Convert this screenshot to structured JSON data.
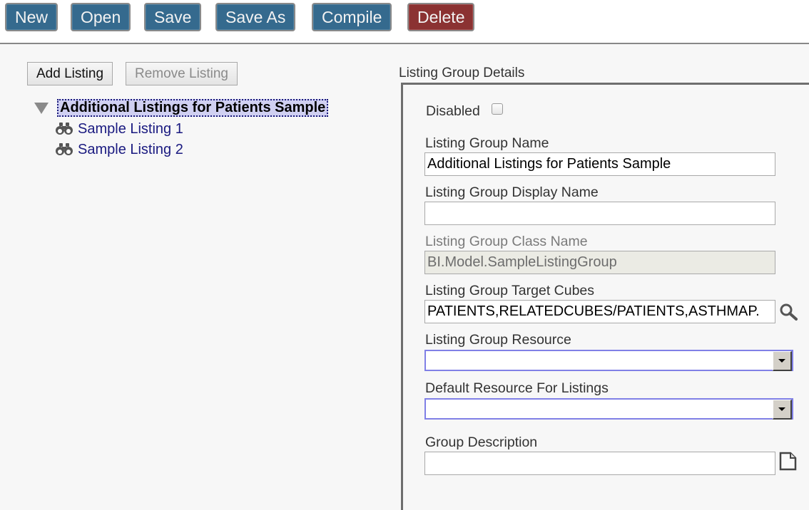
{
  "toolbar": {
    "buttons": [
      {
        "label": "New"
      },
      {
        "label": "Open"
      },
      {
        "label": "Save"
      },
      {
        "label": "Save As"
      },
      {
        "label": "Compile"
      },
      {
        "label": "Delete"
      }
    ]
  },
  "left_panel": {
    "add_listing_label": "Add Listing",
    "remove_listing_label": "Remove Listing",
    "tree": {
      "root": {
        "label": "Additional Listings for Patients Sample",
        "expanded": true,
        "selected": true
      },
      "children": [
        {
          "label": "Sample Listing 1",
          "icon": "binoculars-icon"
        },
        {
          "label": "Sample Listing 2",
          "icon": "binoculars-icon"
        }
      ]
    }
  },
  "details": {
    "title": "Listing Group Details",
    "disabled": {
      "label": "Disabled",
      "checked": false
    },
    "fields": {
      "name": {
        "label": "Listing Group Name",
        "value": "Additional Listings for Patients Sample"
      },
      "display_name": {
        "label": "Listing Group Display Name",
        "value": ""
      },
      "class_name": {
        "label": "Listing Group Class Name",
        "value": "BI.Model.SampleListingGroup",
        "readonly": true
      },
      "target_cubes": {
        "label": "Listing Group Target Cubes",
        "value": "PATIENTS,RELATEDCUBES/PATIENTS,ASTHMAP.",
        "action_icon": "search-icon"
      },
      "resource": {
        "label": "Listing Group Resource",
        "value": ""
      },
      "default_resource": {
        "label": "Default Resource For Listings",
        "value": ""
      },
      "description": {
        "label": "Group Description",
        "value": "",
        "action_icon": "document-icon"
      }
    }
  },
  "colors": {
    "primary_button": "#356a8e",
    "danger_button": "#8b3232",
    "tree_selection": "#d0d0f2",
    "tree_link": "#1a1a80",
    "select_border": "#8080e6"
  }
}
